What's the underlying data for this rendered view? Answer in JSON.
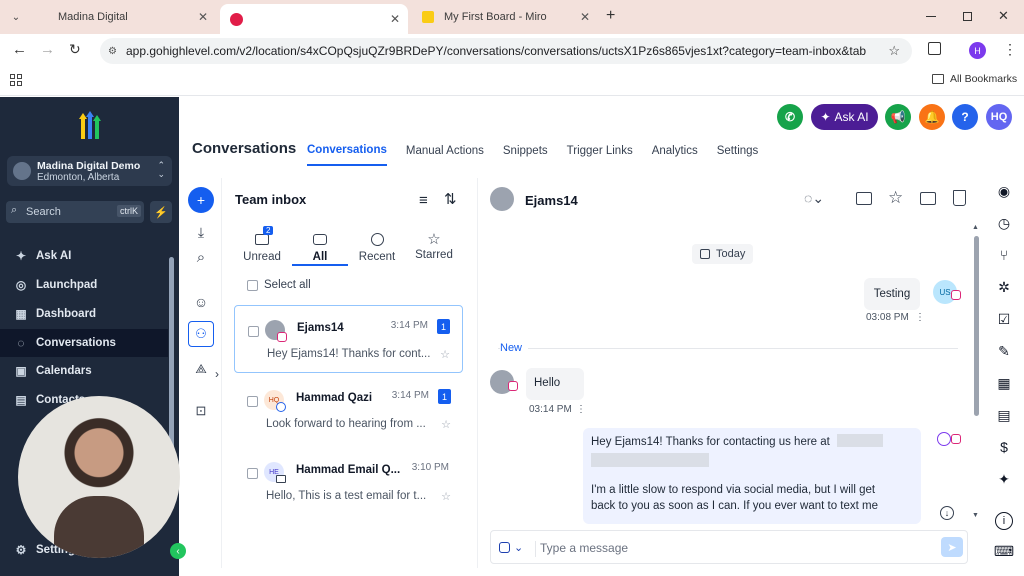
{
  "browser": {
    "tabs": [
      {
        "title": "Madina Digital"
      },
      {
        "title": ""
      },
      {
        "title": "My First Board - Miro"
      }
    ],
    "url": "app.gohighlevel.com/v2/location/s4xCOpQsjuQZr9BRDePY/conversations/conversations/uctsX1Pz6s865vjes1xt?category=team-inbox&tab=all",
    "profile_initial": "H",
    "bookmarks_label": "All Bookmarks"
  },
  "sidebar": {
    "location_name": "Madina Digital Demo",
    "location_city": "Edmonton, Alberta",
    "search_placeholder": "Search",
    "search_shortcut": "ctrlK",
    "items": [
      {
        "label": "Ask AI",
        "icon": "sparkle-icon"
      },
      {
        "label": "Launchpad",
        "icon": "rocket-icon"
      },
      {
        "label": "Dashboard",
        "icon": "dashboard-icon"
      },
      {
        "label": "Conversations",
        "icon": "chat-icon"
      },
      {
        "label": "Calendars",
        "icon": "calendar-icon"
      },
      {
        "label": "Contacts",
        "icon": "contacts-icon"
      }
    ],
    "settings_label": "Settings"
  },
  "header": {
    "title": "Conversations",
    "ask_ai_label": "Ask AI",
    "avatar_initials": "HQ",
    "help_label": "?",
    "tabs": [
      "Conversations",
      "Manual Actions",
      "Snippets",
      "Trigger Links",
      "Analytics",
      "Settings"
    ]
  },
  "inbox": {
    "title": "Team inbox",
    "filters": [
      {
        "label": "Unread",
        "badge": "2"
      },
      {
        "label": "All"
      },
      {
        "label": "Recent"
      },
      {
        "label": "Starred"
      }
    ],
    "select_all_label": "Select all",
    "conversations": [
      {
        "name": "Ejams14",
        "time": "3:14 PM",
        "badge": "1",
        "preview": "Hey Ejams14! Thanks for cont...",
        "avatar": ""
      },
      {
        "name": "Hammad Qazi",
        "time": "3:14 PM",
        "badge": "1",
        "preview": "Look forward to hearing from ...",
        "avatar": "HQ"
      },
      {
        "name": "Hammad Email Q...",
        "time": "3:10 PM",
        "badge": "",
        "preview": "Hello, This is a test email for t...",
        "avatar": "HE"
      }
    ]
  },
  "chat": {
    "contact_name": "Ejams14",
    "date_label": "Today",
    "new_label": "New",
    "messages": [
      {
        "text": "Testing",
        "time": "03:08 PM",
        "avatar": "US"
      },
      {
        "text": "Hello",
        "time": "03:14 PM"
      },
      {
        "line1": "Hey Ejams14! Thanks for contacting us here at",
        "line2": "I'm a little slow to respond via social media, but I will get",
        "line3": "back to you as soon as I can. If you ever want to text me"
      }
    ],
    "input_placeholder": "Type a message"
  },
  "colors": {
    "accent": "#155eef",
    "sidebar_bg": "#1e293b",
    "call_green": "#16a34a",
    "ask_ai_purple": "#4c1d95",
    "notif_orange": "#f97316",
    "help_blue": "#2563eb",
    "avatar_purple": "#6366f1"
  }
}
